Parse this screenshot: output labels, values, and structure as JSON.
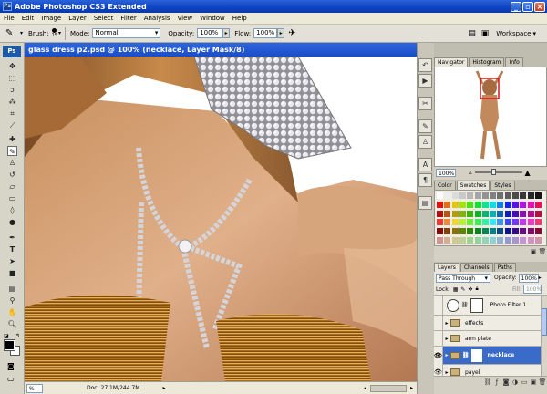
{
  "app": {
    "title": "Adobe Photoshop CS3 Extended",
    "logo": "Ps"
  },
  "menu": [
    "File",
    "Edit",
    "Image",
    "Layer",
    "Select",
    "Filter",
    "Analysis",
    "View",
    "Window",
    "Help"
  ],
  "options": {
    "brush_label": "Brush:",
    "brush_size": "15",
    "mode_label": "Mode:",
    "mode_value": "Normal",
    "opacity_label": "Opacity:",
    "opacity_value": "100%",
    "flow_label": "Flow:",
    "flow_value": "100%",
    "workspace_label": "Workspace"
  },
  "document": {
    "title": "glass dress p2.psd @ 100% (necklace, Layer Mask/8)",
    "zoom": "% ",
    "doc_info": "Doc: 27.1M/244.7M"
  },
  "navigator": {
    "tabs": [
      "Navigator",
      "Histogram",
      "Info"
    ],
    "zoom": "100%"
  },
  "swatches": {
    "tabs": [
      "Color",
      "Swatches",
      "Styles"
    ]
  },
  "layers": {
    "tabs": [
      "Layers",
      "Channels",
      "Paths"
    ],
    "blend_mode": "Pass Through",
    "opacity_label": "Opacity:",
    "opacity_value": "100%",
    "lock_label": "Lock:",
    "fill_label": "Fill:",
    "fill_value": "100%",
    "rows": [
      {
        "name": "Photo Filter 1",
        "type": "adjustment",
        "visible": false
      },
      {
        "name": "effects",
        "type": "group",
        "visible": false
      },
      {
        "name": "arm plate",
        "type": "group",
        "visible": false
      },
      {
        "name": "necklace",
        "type": "group",
        "visible": true,
        "selected": true
      },
      {
        "name": "payel",
        "type": "group",
        "visible": true
      }
    ]
  },
  "colors": {
    "titlebar": "#1a4dc8",
    "selection": "#3a6bc9",
    "panel_bg": "#d4d0c4"
  }
}
